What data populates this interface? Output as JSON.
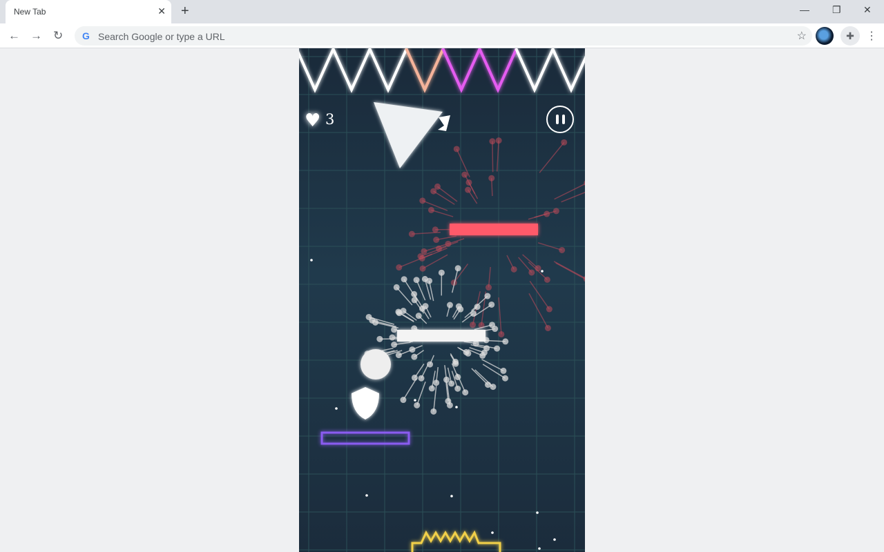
{
  "browser": {
    "tab_title": "New Tab",
    "omnibox_placeholder": "Search Google or type a URL"
  },
  "game": {
    "lives": "3",
    "colors": {
      "spike_white": "#ffffff",
      "spike_peach": "#f5b39a",
      "spike_magenta": "#e45cf0",
      "enemy_red": "#ff5a6a",
      "platform_purple": "#8a5cf0",
      "spring_yellow": "#f2d04a",
      "background": "#203a4c"
    },
    "top_spikes": [
      "white",
      "white",
      "white",
      "peach",
      "magenta",
      "magenta",
      "white",
      "white"
    ],
    "icons": {
      "lives": "heart-icon",
      "pause": "pause-icon",
      "shield": "shield-icon"
    }
  }
}
